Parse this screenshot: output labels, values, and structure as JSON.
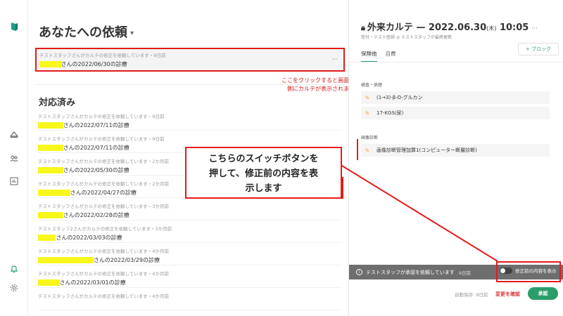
{
  "rail": {
    "icons": [
      "logo-icon",
      "home-icon",
      "users-icon",
      "chart-icon",
      "bell-icon",
      "gear-icon"
    ]
  },
  "list": {
    "title": "あなたへの依頼",
    "request": {
      "meta": "テストスタッフさんがカルテの修正を依頼しています・9日前",
      "record": "さんの2022/06/30の診療"
    },
    "annotation": [
      "ここをクリックすると画面右",
      "側にカルテが表示されます"
    ],
    "done_title": "対応済み",
    "rows": [
      {
        "meta": "テストスタッフさんがカルテの修正を依頼しています・9日前",
        "record": "さんの2022/07/11の診療"
      },
      {
        "meta": "テストスタッフさんがカルテの修正を依頼しています・9日前",
        "record": "さんの2022/07/11の診療"
      },
      {
        "meta": "テストスタッフさんがカルテの修正を依頼しています・2か月前",
        "record": "さんの2022/05/30の診療"
      },
      {
        "meta": "テストスタッフさんがカルテの修正を依頼しています・2か月前",
        "record": "さんの2022/04/27の診療"
      },
      {
        "meta": "テストスタッフさんがカルテの修正を依頼しています・3か月前",
        "record": "さんの2022/02/28の診療"
      },
      {
        "meta": "テストスタッフ2さんがカルテの修正を依頼しています・3か月前",
        "record": "さんの2022/03/03の診療"
      },
      {
        "meta": "テストスタッフさんがカルテの修正を依頼しています・4か月前",
        "record": "さんの2022/03/29の診療"
      },
      {
        "meta": "テストスタッフさんがカルテの修正を依頼しています・4か月前",
        "record": "さんの2022/03/01の診療"
      },
      {
        "meta": "テストスタッフさんがカルテの修正を依頼しています・4か月前",
        "record": ""
      }
    ]
  },
  "chart": {
    "title": "外来カルテ — 2022.06.30",
    "dow": "(木)",
    "time": "10:05",
    "sub": "受付・テスト医師 ◎ テストスタッフが最終更新",
    "tabs": [
      "保険他",
      "自費"
    ],
    "block_button": "+ ブロック",
    "sections": [
      {
        "label": "検査・病理",
        "entries": [
          "(1→3)-β-D-グルカン",
          "17-KGS(尿)"
        ]
      },
      {
        "label": "画像診断",
        "entries": [
          "画像診断管理加算1(コンピューター断層診断)"
        ]
      }
    ],
    "status": "テストスタッフが承認を依頼しています",
    "status_ago": "9日前",
    "switch_label": "修正前の内容を表示",
    "autosave": "自動保存: 9日前",
    "confirm_link": "変更を確認",
    "approve_button": "承認"
  },
  "callout": [
    "こちらのスイッチボタンを",
    "押して、修正前の内容を表",
    "示します"
  ],
  "colors": {
    "accent": "#2a9d6b",
    "annotation": "#e31b1b",
    "highlight": "#f7f71c",
    "status_bar": "#6e6e6e"
  }
}
